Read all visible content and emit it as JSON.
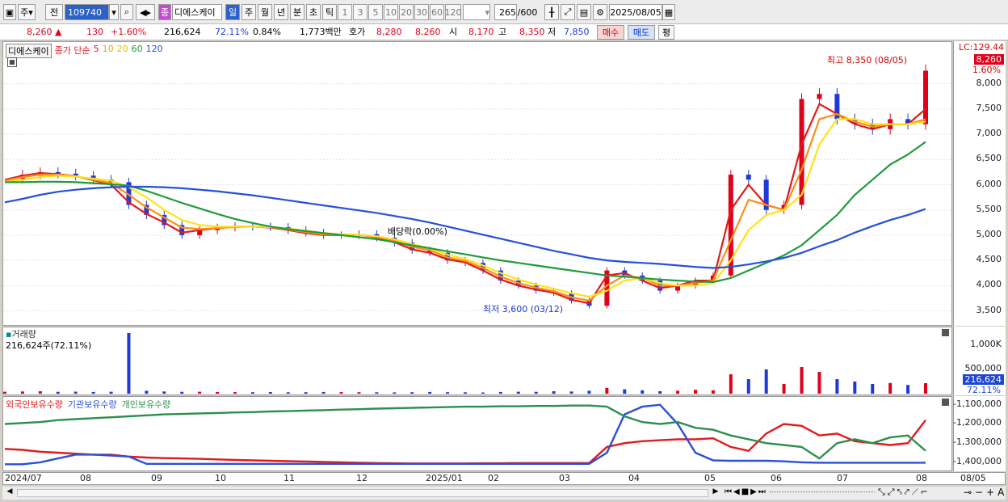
{
  "toolbar": {
    "market_type": "주",
    "prev_label": "전",
    "code": "109740",
    "stock_badge": "종",
    "stock_name": "디에스케이",
    "periods": [
      "일",
      "주",
      "월",
      "년",
      "분",
      "초",
      "틱"
    ],
    "intervals": [
      "1",
      "3",
      "5",
      "10",
      "20",
      "30",
      "60",
      "120"
    ],
    "count": "265",
    "count_max": "/600",
    "date": "2025/08/05"
  },
  "price_row": {
    "price": "8,260",
    "change": "130",
    "change_pct": "+1.60%",
    "volume": "216,624",
    "volume_pct": "72.11%",
    "turnover": "0.84%",
    "amount": "1,773백만",
    "bid_label": "호가",
    "ask": "8,280",
    "bid": "8,260",
    "open_label": "시",
    "open": "8,170",
    "high_label": "고",
    "high": "8,350",
    "low_label": "저",
    "low": "7,850",
    "buy_label": "매수",
    "sell_label": "매도",
    "avg_label": "평"
  },
  "chart_data": [
    {
      "type": "line",
      "name": "price",
      "legend_stock": "디에스케이",
      "legend_title": "종가 단순",
      "legend_periods": [
        "5",
        "10",
        "20",
        "60",
        "120"
      ],
      "ylim": [
        3300,
        8700
      ],
      "yticks": [
        "3,500",
        "4,000",
        "4,500",
        "5,000",
        "5,500",
        "6,000",
        "6,500",
        "7,000",
        "7,500",
        "8,000"
      ],
      "lc_label": "LC:129.44",
      "last_price": "8,260",
      "last_pct": "1.60%",
      "annotations": {
        "high": "최고 8,350 (08/05)",
        "low": "최저 3,600 (03/12)",
        "dividend": "배당락(0.00%)"
      },
      "series": [
        {
          "name": "close",
          "color": "#2b3fd1",
          "values": [
            6120,
            6200,
            6250,
            6220,
            6180,
            6100,
            6050,
            5600,
            5400,
            5200,
            5000,
            5100,
            5150,
            5180,
            5170,
            5160,
            5100,
            5050,
            5000,
            5000,
            5020,
            4950,
            4850,
            4700,
            4650,
            4500,
            4450,
            4300,
            4100,
            4000,
            3900,
            3850,
            3700,
            3600,
            4300,
            4200,
            4100,
            3900,
            4000,
            4100,
            4200,
            6200,
            6100,
            5500,
            5600,
            7700,
            7800,
            7300,
            7200,
            7100,
            7300,
            7200,
            8260
          ]
        },
        {
          "name": "5",
          "color": "#e01a1a",
          "values": [
            6100,
            6180,
            6230,
            6210,
            6170,
            6090,
            6000,
            5650,
            5420,
            5250,
            5050,
            5100,
            5140,
            5170,
            5170,
            5150,
            5100,
            5040,
            5000,
            5000,
            5010,
            4960,
            4860,
            4720,
            4650,
            4520,
            4460,
            4300,
            4120,
            4000,
            3920,
            3860,
            3720,
            3650,
            4200,
            4250,
            4100,
            3950,
            4000,
            4100,
            4100,
            5500,
            6000,
            5600,
            5500,
            6800,
            7600,
            7400,
            7200,
            7100,
            7200,
            7200,
            7500
          ]
        },
        {
          "name": "10",
          "color": "#ff8c1a",
          "values": [
            6080,
            6150,
            6200,
            6200,
            6170,
            6100,
            6030,
            5800,
            5550,
            5350,
            5150,
            5120,
            5140,
            5160,
            5170,
            5160,
            5110,
            5060,
            5010,
            5000,
            5010,
            4970,
            4890,
            4770,
            4700,
            4560,
            4490,
            4350,
            4180,
            4050,
            3960,
            3890,
            3770,
            3700,
            4000,
            4200,
            4150,
            4000,
            4000,
            4050,
            4100,
            4900,
            5700,
            5600,
            5500,
            6300,
            7300,
            7400,
            7250,
            7150,
            7200,
            7200,
            7300
          ]
        },
        {
          "name": "20",
          "color": "#ffe21a",
          "values": [
            6050,
            6100,
            6150,
            6180,
            6160,
            6120,
            6080,
            5950,
            5750,
            5500,
            5300,
            5200,
            5170,
            5170,
            5170,
            5160,
            5130,
            5090,
            5040,
            5020,
            5010,
            4980,
            4920,
            4820,
            4740,
            4610,
            4530,
            4400,
            4250,
            4120,
            4020,
            3940,
            3850,
            3780,
            3900,
            4100,
            4150,
            4050,
            4000,
            4000,
            4050,
            4500,
            5100,
            5400,
            5500,
            5800,
            6800,
            7300,
            7300,
            7200,
            7200,
            7200,
            7250
          ]
        },
        {
          "name": "60",
          "color": "#1f9a3c",
          "values": [
            6050,
            6050,
            6060,
            6060,
            6050,
            6030,
            6010,
            5980,
            5880,
            5760,
            5640,
            5530,
            5420,
            5320,
            5240,
            5170,
            5120,
            5080,
            5040,
            5000,
            4960,
            4920,
            4860,
            4800,
            4740,
            4680,
            4620,
            4560,
            4500,
            4450,
            4400,
            4350,
            4300,
            4250,
            4200,
            4180,
            4150,
            4120,
            4100,
            4080,
            4070,
            4150,
            4300,
            4450,
            4600,
            4800,
            5100,
            5400,
            5800,
            6100,
            6400,
            6600,
            6850
          ]
        },
        {
          "name": "120",
          "color": "#2450db",
          "values": [
            5650,
            5720,
            5800,
            5860,
            5900,
            5930,
            5950,
            5960,
            5960,
            5950,
            5930,
            5900,
            5870,
            5830,
            5790,
            5740,
            5690,
            5640,
            5590,
            5540,
            5490,
            5440,
            5380,
            5320,
            5250,
            5170,
            5090,
            5010,
            4930,
            4850,
            4770,
            4690,
            4620,
            4550,
            4500,
            4470,
            4450,
            4430,
            4400,
            4370,
            4350,
            4370,
            4420,
            4480,
            4550,
            4650,
            4780,
            4900,
            5050,
            5180,
            5300,
            5400,
            5520
          ]
        }
      ]
    },
    {
      "type": "bar",
      "name": "volume",
      "legend_title": "거래량",
      "current": "216,624주(72.11%)",
      "ylim": [
        0,
        1300000
      ],
      "yticks": [
        "1,000K",
        "500,000"
      ],
      "last_value": "216,624",
      "last_pct": "72.11%",
      "values": [
        40000,
        45000,
        50000,
        38000,
        42000,
        35000,
        40000,
        1250000,
        60000,
        45000,
        38000,
        40000,
        35000,
        32000,
        30000,
        33000,
        28000,
        30000,
        35000,
        32000,
        30000,
        28000,
        26000,
        30000,
        35000,
        30000,
        28000,
        25000,
        35000,
        40000,
        38000,
        50000,
        45000,
        60000,
        120000,
        90000,
        70000,
        50000,
        60000,
        80000,
        70000,
        400000,
        300000,
        500000,
        200000,
        550000,
        450000,
        300000,
        250000,
        200000,
        220000,
        180000,
        216624
      ]
    },
    {
      "type": "line",
      "name": "holdings",
      "legend": [
        "외국인보유수량",
        "기관보유수량",
        "개인보유수량"
      ],
      "ylim": [
        -1430000,
        -1080000
      ],
      "yticks": [
        "-1,100,000",
        "-1,200,000",
        "-1,300,000",
        "-1,400,000"
      ],
      "series": [
        {
          "name": "외국인보유수량",
          "color": "#e01a1a",
          "values": [
            -1330000,
            -1335000,
            -1345000,
            -1350000,
            -1355000,
            -1360000,
            -1360000,
            -1370000,
            -1375000,
            -1378000,
            -1380000,
            -1382000,
            -1385000,
            -1388000,
            -1390000,
            -1392000,
            -1394000,
            -1396000,
            -1398000,
            -1400000,
            -1402000,
            -1404000,
            -1405000,
            -1406000,
            -1406000,
            -1406000,
            -1406000,
            -1405000,
            -1405000,
            -1404000,
            -1404000,
            -1404000,
            -1404000,
            -1404000,
            -1320000,
            -1300000,
            -1290000,
            -1285000,
            -1280000,
            -1280000,
            -1275000,
            -1320000,
            -1340000,
            -1250000,
            -1200000,
            -1210000,
            -1260000,
            -1250000,
            -1290000,
            -1300000,
            -1310000,
            -1300000,
            -1180000
          ]
        },
        {
          "name": "기관보유수량",
          "color": "#2b4fd9",
          "values": [
            -1410000,
            -1410000,
            -1400000,
            -1380000,
            -1360000,
            -1360000,
            -1365000,
            -1370000,
            -1408000,
            -1408000,
            -1408000,
            -1408000,
            -1408000,
            -1408000,
            -1408000,
            -1408000,
            -1408000,
            -1408000,
            -1408000,
            -1408000,
            -1408000,
            -1408000,
            -1408000,
            -1408000,
            -1408000,
            -1408000,
            -1408000,
            -1408000,
            -1408000,
            -1408000,
            -1408000,
            -1408000,
            -1408000,
            -1408000,
            -1350000,
            -1150000,
            -1110000,
            -1100000,
            -1200000,
            -1350000,
            -1390000,
            -1392000,
            -1392000,
            -1392000,
            -1395000,
            -1400000,
            -1402000,
            -1402000,
            -1402000,
            -1402000,
            -1402000,
            -1402000,
            -1402000
          ]
        },
        {
          "name": "개인보유수량",
          "color": "#2d8f4c",
          "values": [
            -1200000,
            -1195000,
            -1190000,
            -1180000,
            -1175000,
            -1170000,
            -1165000,
            -1160000,
            -1155000,
            -1150000,
            -1148000,
            -1145000,
            -1143000,
            -1140000,
            -1138000,
            -1135000,
            -1133000,
            -1130000,
            -1128000,
            -1125000,
            -1123000,
            -1120000,
            -1118000,
            -1116000,
            -1114000,
            -1112000,
            -1110000,
            -1110000,
            -1108000,
            -1108000,
            -1106000,
            -1106000,
            -1104000,
            -1104000,
            -1110000,
            -1160000,
            -1190000,
            -1200000,
            -1190000,
            -1220000,
            -1230000,
            -1260000,
            -1280000,
            -1300000,
            -1310000,
            -1320000,
            -1380000,
            -1300000,
            -1280000,
            -1300000,
            -1270000,
            -1260000,
            -1340000
          ]
        }
      ]
    }
  ],
  "x_axis": {
    "labels": [
      "2024/07",
      "08",
      "09",
      "10",
      "11",
      "12",
      "2025/01",
      "02",
      "03",
      "04",
      "05",
      "06",
      "07",
      "08",
      "08/05"
    ]
  }
}
